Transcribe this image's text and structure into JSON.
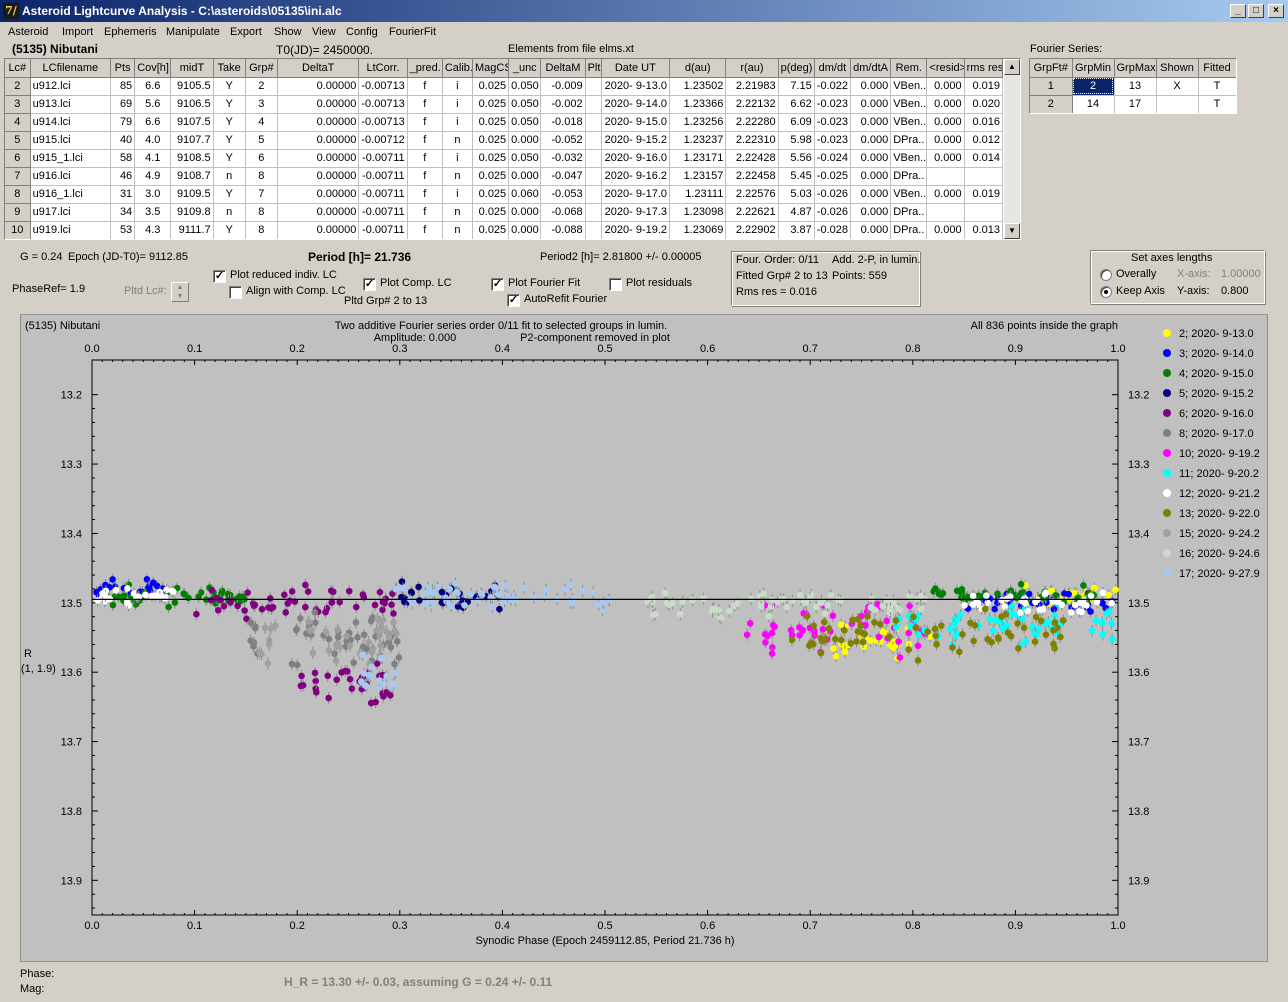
{
  "window": {
    "title": "Asteroid Lightcurve Analysis - C:\\asteroids\\05135\\ini.alc",
    "icon_glyph": "7/"
  },
  "menu": [
    "Asteroid",
    "Import",
    "Ephemeris",
    "Manipulate",
    "Export",
    "Show",
    "View",
    "Config",
    "FourierFit"
  ],
  "header": {
    "asteroid": "(5135) Nibutani",
    "t0": "T0(JD)= 2450000.",
    "elements": "Elements from file elms.xt"
  },
  "lc_table": {
    "columns": [
      "Lc#",
      "LCfilename",
      "Pts",
      "Cov[h]",
      "midT",
      "Take",
      "Grp#",
      "DeltaT",
      "LtCorr.",
      "_pred.",
      "Calib.",
      "MagCS",
      "_unc",
      "DeltaM",
      "Plt",
      "Date UT",
      "d(au)",
      "r(au)",
      "p(deg)",
      "dm/dt",
      "dm/dtA",
      "Rem.",
      "<resid>",
      "rms res"
    ],
    "rows": [
      [
        "2",
        "u912.lci",
        "85",
        "6.6",
        "9105.5",
        "Y",
        "2",
        "0.00000",
        "-0.00713",
        "f",
        "i",
        "0.025",
        "0.050",
        "-0.009",
        "",
        "2020- 9-13.0",
        "1.23502",
        "2.21983",
        "7.15",
        "-0.022",
        "0.000",
        "VBen..",
        "0.000",
        "0.019"
      ],
      [
        "3",
        "u913.lci",
        "69",
        "5.6",
        "9106.5",
        "Y",
        "3",
        "0.00000",
        "-0.00713",
        "f",
        "i",
        "0.025",
        "0.050",
        "-0.002",
        "",
        "2020- 9-14.0",
        "1.23366",
        "2.22132",
        "6.62",
        "-0.023",
        "0.000",
        "VBen..",
        "0.000",
        "0.020"
      ],
      [
        "4",
        "u914.lci",
        "79",
        "6.6",
        "9107.5",
        "Y",
        "4",
        "0.00000",
        "-0.00713",
        "f",
        "i",
        "0.025",
        "0.050",
        "-0.018",
        "",
        "2020- 9-15.0",
        "1.23256",
        "2.22280",
        "6.09",
        "-0.023",
        "0.000",
        "VBen..",
        "0.000",
        "0.016"
      ],
      [
        "5",
        "u915.lci",
        "40",
        "4.0",
        "9107.7",
        "Y",
        "5",
        "0.00000",
        "-0.00712",
        "f",
        "n",
        "0.025",
        "0.000",
        "-0.052",
        "",
        "2020- 9-15.2",
        "1.23237",
        "2.22310",
        "5.98",
        "-0.023",
        "0.000",
        "DPra..",
        "0.000",
        "0.012"
      ],
      [
        "6",
        "u915_1.lci",
        "58",
        "4.1",
        "9108.5",
        "Y",
        "6",
        "0.00000",
        "-0.00711",
        "f",
        "i",
        "0.025",
        "0.050",
        "-0.032",
        "",
        "2020- 9-16.0",
        "1.23171",
        "2.22428",
        "5.56",
        "-0.024",
        "0.000",
        "VBen..",
        "0.000",
        "0.014"
      ],
      [
        "7",
        "u916.lci",
        "46",
        "4.9",
        "9108.7",
        "n",
        "8",
        "0.00000",
        "-0.00711",
        "f",
        "n",
        "0.025",
        "0.000",
        "-0.047",
        "",
        "2020- 9-16.2",
        "1.23157",
        "2.22458",
        "5.45",
        "-0.025",
        "0.000",
        "DPra..",
        "",
        ""
      ],
      [
        "8",
        "u916_1.lci",
        "31",
        "3.0",
        "9109.5",
        "Y",
        "7",
        "0.00000",
        "-0.00711",
        "f",
        "i",
        "0.025",
        "0.060",
        "-0.053",
        "",
        "2020- 9-17.0",
        "1.23111",
        "2.22576",
        "5.03",
        "-0.026",
        "0.000",
        "VBen..",
        "0.000",
        "0.019"
      ],
      [
        "9",
        "u917.lci",
        "34",
        "3.5",
        "9109.8",
        "n",
        "8",
        "0.00000",
        "-0.00711",
        "f",
        "n",
        "0.025",
        "0.000",
        "-0.068",
        "",
        "2020- 9-17.3",
        "1.23098",
        "2.22621",
        "4.87",
        "-0.026",
        "0.000",
        "DPra..",
        "",
        ""
      ],
      [
        "10",
        "u919.lci",
        "53",
        "4.3",
        "9111.7",
        "Y",
        "8",
        "0.00000",
        "-0.00711",
        "f",
        "n",
        "0.025",
        "0.000",
        "-0.088",
        "",
        "2020- 9-19.2",
        "1.23069",
        "2.22902",
        "3.87",
        "-0.028",
        "0.000",
        "DPra..",
        "0.000",
        "0.013"
      ]
    ]
  },
  "fourier_table": {
    "title": "Fourier Series:",
    "columns": [
      "GrpFt#",
      "GrpMin",
      "GrpMax",
      "Shown",
      "Fitted"
    ],
    "rows": [
      [
        "1",
        "2",
        "13",
        "X",
        "T"
      ],
      [
        "2",
        "14",
        "17",
        "",
        "T"
      ]
    ]
  },
  "controls": {
    "g": "G = 0.24",
    "epoch": "Epoch (JD-T0)= 9112.85",
    "period": "Period [h]= 21.736",
    "period2": "Period2 [h]= 2.81800 +/- 0.00005",
    "phaseref": "PhaseRef= 1.9",
    "pltd_lc": "Pltd Lc#:",
    "plot_reduced": {
      "label": "Plot reduced indiv. LC",
      "checked": true
    },
    "align_comp": {
      "label": "Align with Comp. LC",
      "checked": false
    },
    "plot_comp": {
      "label": "Plot Comp. LC",
      "checked": true
    },
    "pltd_grp": "Pltd Grp#  2   to   13",
    "plot_fourier": {
      "label": "Plot Fourier Fit",
      "checked": true
    },
    "autorefit": {
      "label": "AutoRefit Fourier",
      "checked": true
    },
    "plot_residuals": {
      "label": "Plot residuals",
      "checked": false
    }
  },
  "fit_info": {
    "line1a": "Four. Order:  0/11",
    "line1b": "Add. 2-P, in lumin.",
    "line2a": "Fitted Grp# 2 to 13",
    "line2b": "Points: 559",
    "line3": "Rms res      = 0.016"
  },
  "axes_box": {
    "title": "Set axes lengths",
    "overally": "Overally",
    "keep_axis": "Keep Axis",
    "xaxis_label": "X-axis:",
    "xaxis_val": "1.00000",
    "yaxis_label": "Y-axis:",
    "yaxis_val": "0.800",
    "selected": "keep_axis"
  },
  "chart_data": {
    "type": "scatter",
    "title_left": "(5135) Nibutani",
    "title_center_1": "Two additive Fourier series order 0/11 fit to selected groups in lumin.",
    "title_center_2": "Amplitude: 0.000",
    "title_center_3": "P2-component removed in plot",
    "title_right": "All 836 points inside the graph",
    "xlabel": "Synodic Phase (Epoch 2459112.85, Period 21.736 h)",
    "ylabel": "R",
    "ylabel_sub": "(1, 1.9)",
    "xlim": [
      0.0,
      1.0
    ],
    "ylim": [
      13.15,
      13.95
    ],
    "y_inverted": true,
    "xticks": [
      "0.0",
      "0.1",
      "0.2",
      "0.3",
      "0.4",
      "0.5",
      "0.6",
      "0.7",
      "0.8",
      "0.9",
      "1.0"
    ],
    "yticks": [
      "13.2",
      "13.3",
      "13.4",
      "13.5",
      "13.6",
      "13.7",
      "13.8",
      "13.9"
    ],
    "fit_line_y": 13.495,
    "series": [
      {
        "name": "2; 2020- 9-13.0",
        "color": "#ffff00",
        "segments": [
          [
            0.7,
            0.82,
            13.55,
            0.04
          ],
          [
            0.9,
            1.0,
            13.49,
            0.02
          ]
        ]
      },
      {
        "name": "3; 2020- 9-14.0",
        "color": "#0000ff",
        "segments": [
          [
            0.0,
            0.07,
            13.48,
            0.02
          ],
          [
            0.85,
            1.0,
            13.5,
            0.02
          ]
        ]
      },
      {
        "name": "4; 2020- 9-15.0",
        "color": "#008000",
        "segments": [
          [
            0.0,
            0.15,
            13.49,
            0.02
          ],
          [
            0.82,
            0.98,
            13.49,
            0.02
          ]
        ]
      },
      {
        "name": "5; 2020- 9-15.2",
        "color": "#000080",
        "segments": [
          [
            0.3,
            0.4,
            13.49,
            0.03
          ]
        ]
      },
      {
        "name": "6; 2020- 9-16.0",
        "color": "#800080",
        "segments": [
          [
            0.1,
            0.3,
            13.5,
            0.03
          ],
          [
            0.2,
            0.3,
            13.62,
            0.04
          ]
        ]
      },
      {
        "name": "8; 2020- 9-17.0",
        "color": "#808080",
        "segments": [
          [
            0.14,
            0.3,
            13.55,
            0.06
          ]
        ]
      },
      {
        "name": "10; 2020- 9-19.2",
        "color": "#ff00ff",
        "segments": [
          [
            0.63,
            0.82,
            13.54,
            0.05
          ]
        ]
      },
      {
        "name": "11; 2020- 9-20.2",
        "color": "#00ffff",
        "segments": [
          [
            0.78,
            1.0,
            13.53,
            0.04
          ]
        ]
      },
      {
        "name": "12; 2020- 9-21.2",
        "color": "#ffffff",
        "segments": [
          [
            0.0,
            0.08,
            13.49,
            0.02
          ],
          [
            0.85,
            1.0,
            13.5,
            0.02
          ]
        ]
      },
      {
        "name": "13; 2020- 9-22.0",
        "color": "#808000",
        "segments": [
          [
            0.68,
            0.95,
            13.54,
            0.05
          ]
        ]
      },
      {
        "name": "15; 2020- 9-24.2",
        "color": "#a0a0a0",
        "segments": [
          [
            0.16,
            0.3,
            13.55,
            0.05
          ]
        ]
      },
      {
        "name": "16; 2020- 9-24.6",
        "color": "#c8dcc8",
        "segments": [
          [
            0.54,
            0.82,
            13.5,
            0.03
          ]
        ]
      },
      {
        "name": "17; 2020- 9-27.9",
        "color": "#a8c8f0",
        "segments": [
          [
            0.29,
            0.51,
            13.49,
            0.03
          ],
          [
            0.26,
            0.3,
            13.6,
            0.04
          ]
        ]
      }
    ]
  },
  "status": {
    "phase": "Phase:",
    "mag": "Mag:",
    "h_r": "H_R = 13.30 +/- 0.03, assuming G = 0.24 +/- 0.11"
  }
}
